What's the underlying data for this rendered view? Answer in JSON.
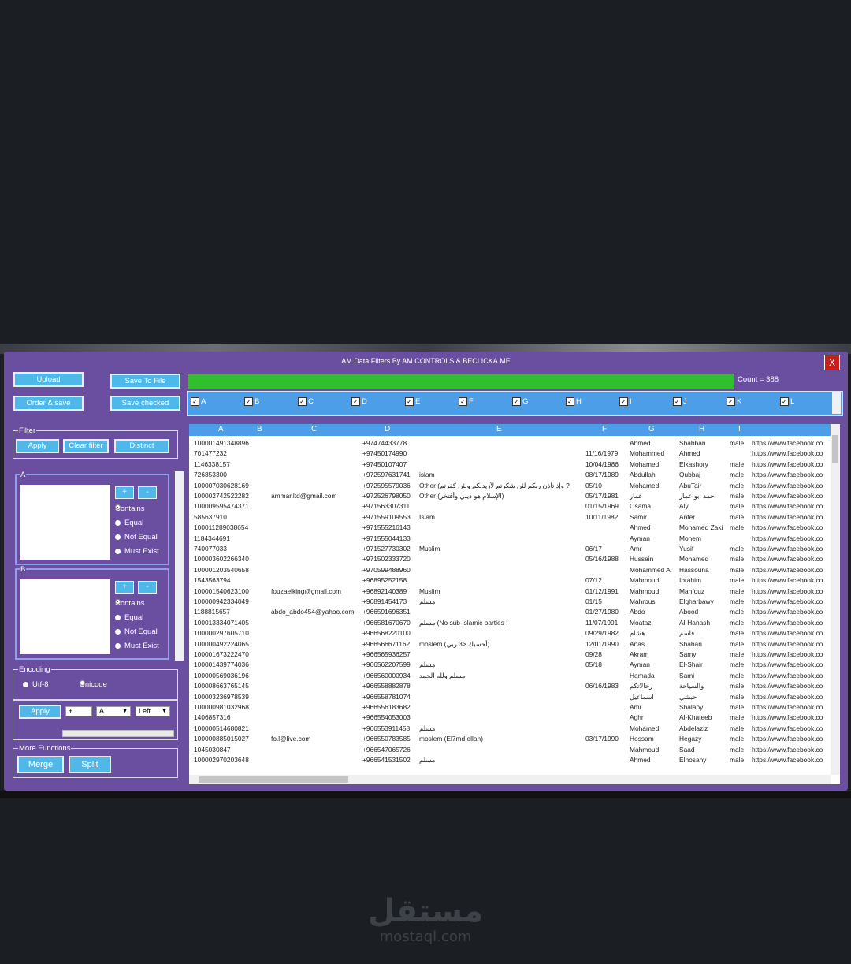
{
  "window": {
    "title": "AM Data Filters By AM CONTROLS & BECLICKA.ME",
    "close_label": "X"
  },
  "toolbar": {
    "upload": "Upload",
    "order_save": "Order & save",
    "save_to_file": "Save To File",
    "save_checked": "Save checked",
    "count": "Count = 388"
  },
  "columns_checks": [
    "A",
    "B",
    "C",
    "D",
    "E",
    "F",
    "G",
    "H",
    "I",
    "J",
    "K",
    "L"
  ],
  "filter": {
    "label": "Filter",
    "apply": "Apply",
    "clear": "Clear filter",
    "distinct": "Distinct"
  },
  "groupA": {
    "label": "A",
    "plus": "+",
    "minus": "-",
    "options": [
      "Contains",
      "Equal",
      "Not Equal",
      "Must Exist"
    ]
  },
  "groupB": {
    "label": "B",
    "plus": "+",
    "minus": "-",
    "options": [
      "Contains",
      "Equal",
      "Not Equal",
      "Must Exist"
    ]
  },
  "encoding": {
    "label": "Encoding",
    "utf8": "Utf-8",
    "unicode": "Unicode",
    "apply": "Apply",
    "input_value": "+",
    "col_select": "A",
    "align_select": "Left"
  },
  "more": {
    "label": "More Functions",
    "merge": "Merge",
    "split": "Split"
  },
  "grid": {
    "headers": [
      "A",
      "B",
      "C",
      "D",
      "E",
      "F",
      "G",
      "H",
      "I"
    ],
    "rows": [
      [
        "100001491348896",
        "",
        "",
        "+97474433778",
        "",
        "",
        "Ahmed",
        "Shabban",
        "male",
        "https://www.facebook.co"
      ],
      [
        "701477232",
        "",
        "",
        "+97450174990",
        "",
        "11/16/1979",
        "Mohammed",
        "Ahmed",
        "",
        "https://www.facebook.co"
      ],
      [
        "1146338157",
        "",
        "",
        "+97450107407",
        "",
        "10/04/1986",
        "Mohamed",
        "Elkashory",
        "male",
        "https://www.facebook.co"
      ],
      [
        "726853300",
        "",
        "",
        "+972597631741",
        "islam",
        "08/17/1989",
        "Abdullah",
        "Qubbaj",
        "male",
        "https://www.facebook.co"
      ],
      [
        "100007030628169",
        "",
        "",
        "+972595579036",
        "Other (وإذ تأذن ربكم لئن شكرتم لأزيدنكم ولئن كفرتم ?",
        "05/10",
        "Mohamed",
        "AbuTair",
        "male",
        "https://www.facebook.co"
      ],
      [
        "100002742522282",
        "",
        "ammar.ltd@gmail.com",
        "+972526798050",
        "Other (الإسلام هو ديني وأفتخر)",
        "05/17/1981",
        "عمار",
        "احمد ابو عمار",
        "male",
        "https://www.facebook.co"
      ],
      [
        "100009595474371",
        "",
        "",
        "+971563307311",
        "",
        "01/15/1969",
        "Osama",
        "Aly",
        "male",
        "https://www.facebook.co"
      ],
      [
        "585637910",
        "",
        "",
        "+971559109553",
        "Islam",
        "10/11/1982",
        "Samir",
        "Anter",
        "male",
        "https://www.facebook.co"
      ],
      [
        "100011289038654",
        "",
        "",
        "+971555216143",
        "",
        "",
        "Ahmed",
        "Mohamed Zaki",
        "male",
        "https://www.facebook.co"
      ],
      [
        "1184344691",
        "",
        "",
        "+971555044133",
        "",
        "",
        "Ayman",
        "Monem",
        "",
        "https://www.facebook.co"
      ],
      [
        "740077033",
        "",
        "",
        "+971527730302",
        "Muslim",
        "06/17",
        "Amr",
        "Yusif",
        "male",
        "https://www.facebook.co"
      ],
      [
        "100003602266340",
        "",
        "",
        "+971502333720",
        "",
        "05/16/1988",
        "Hussein",
        "Mohamed",
        "male",
        "https://www.facebook.co"
      ],
      [
        "100001203540658",
        "",
        "",
        "+970599488960",
        "",
        "",
        "Mohammed A.",
        "Hassouna",
        "male",
        "https://www.facebook.co"
      ],
      [
        "1543563794",
        "",
        "",
        "+96895252158",
        "",
        "07/12",
        "Mahmoud",
        "Ibrahim",
        "male",
        "https://www.facebook.co"
      ],
      [
        "100001540623100",
        "",
        "fouzaelking@gmail.com",
        "+96892140389",
        "Muslim",
        "01/12/1991",
        "Mahmoud",
        "Mahfouz",
        "male",
        "https://www.facebook.co"
      ],
      [
        "100000942334049",
        "",
        "",
        "+96891454173",
        "مسلم",
        "01/15",
        "Mahrous",
        "Elgharbawy",
        "male",
        "https://www.facebook.co"
      ],
      [
        "1188815657",
        "",
        "abdo_abdo454@yahoo.com",
        "+966591696351",
        "",
        "01/27/1980",
        "Abdo",
        "Abood",
        "male",
        "https://www.facebook.co"
      ],
      [
        "100013334071405",
        "",
        "",
        "+966581670670",
        "مسلم (No sub-islamic parties !",
        "11/07/1991",
        "Moataz",
        "Al-Hanash",
        "male",
        "https://www.facebook.co"
      ],
      [
        "100000297605710",
        "",
        "",
        "+966568220100",
        "",
        "09/29/1982",
        "هشام",
        "قاسم",
        "male",
        "https://www.facebook.co"
      ],
      [
        "100000492224065",
        "",
        "",
        "+966566671162",
        "moslem (أحسبك <3 ربي)",
        "12/01/1990",
        "Anas",
        "Shaban",
        "male",
        "https://www.facebook.co"
      ],
      [
        "100001673222470",
        "",
        "",
        "+966565936257",
        "",
        "09/28",
        "Akram",
        "Samy",
        "male",
        "https://www.facebook.co"
      ],
      [
        "100001439774036",
        "",
        "",
        "+966562207599",
        "مسلم",
        "05/18",
        "Ayman",
        "El-Shair",
        "male",
        "https://www.facebook.co"
      ],
      [
        "100000569036196",
        "",
        "",
        "+966560000934",
        "مسلم ولله الحمد",
        "",
        "Hamada",
        "Sami",
        "male",
        "https://www.facebook.co"
      ],
      [
        "100008663765145",
        "",
        "",
        "+966558882878",
        "",
        "06/16/1983",
        "رحالاتكم",
        "والسياحة",
        "male",
        "https://www.facebook.co"
      ],
      [
        "100003236978539",
        "",
        "",
        "+966558781074",
        "",
        "",
        "اسماعيل",
        "حبشي",
        "male",
        "https://www.facebook.co"
      ],
      [
        "100000981032968",
        "",
        "",
        "+966556183682",
        "",
        "",
        "Amr",
        "Shalapy",
        "male",
        "https://www.facebook.co"
      ],
      [
        "1406857316",
        "",
        "",
        "+966554053003",
        "",
        "",
        "Aghr",
        "Al-Khateeb",
        "male",
        "https://www.facebook.co"
      ],
      [
        "100000514680821",
        "",
        "",
        "+966553911458",
        "مسلم",
        "",
        "Mohamed",
        "Abdelaziz",
        "male",
        "https://www.facebook.co"
      ],
      [
        "100000885015027",
        "",
        "fo.l@live.com",
        "+966550783585",
        "moslem (El7md ellah)",
        "03/17/1990",
        "Hossam",
        "Hegazy",
        "male",
        "https://www.facebook.co"
      ],
      [
        "1045030847",
        "",
        "",
        "+966547065726",
        "",
        "",
        "Mahmoud",
        "Saad",
        "male",
        "https://www.facebook.co"
      ],
      [
        "100002970203648",
        "",
        "",
        "+966541531502",
        "مسلم",
        "",
        "Ahmed",
        "Elhosany",
        "male",
        "https://www.facebook.co"
      ]
    ]
  },
  "watermark": {
    "arabic": "مستقل",
    "latin": "mostaql.com"
  }
}
